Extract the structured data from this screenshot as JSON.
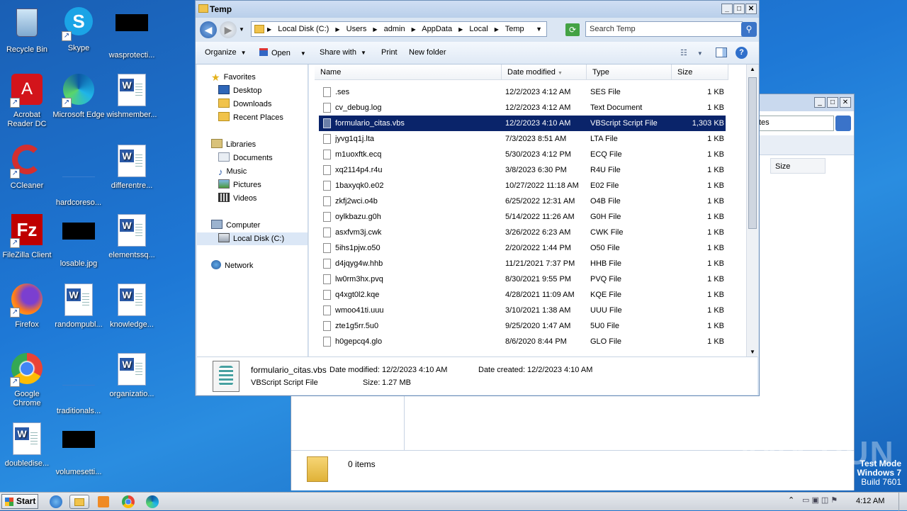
{
  "desktop": {
    "icons": [
      {
        "label": "Recycle Bin",
        "icon": "recycle-bin-icon"
      },
      {
        "label": "Skype",
        "icon": "skype-icon"
      },
      {
        "label": "wasprotecti...",
        "icon": "black-thumbnail-icon"
      },
      {
        "label": "Acrobat Reader DC",
        "icon": "acrobat-icon"
      },
      {
        "label": "Microsoft Edge",
        "icon": "edge-icon"
      },
      {
        "label": "wishmember...",
        "icon": "word-doc-icon"
      },
      {
        "label": "CCleaner",
        "icon": "ccleaner-icon"
      },
      {
        "label": "hardcoreso...",
        "icon": "blank-thumbnail-icon"
      },
      {
        "label": "differentre...",
        "icon": "word-doc-icon"
      },
      {
        "label": "FileZilla Client",
        "icon": "filezilla-icon"
      },
      {
        "label": "losable.jpg",
        "icon": "black-thumbnail-icon"
      },
      {
        "label": "elementssq...",
        "icon": "word-doc-icon"
      },
      {
        "label": "Firefox",
        "icon": "firefox-icon"
      },
      {
        "label": "randompubl...",
        "icon": "word-doc-icon"
      },
      {
        "label": "knowledge...",
        "icon": "word-doc-icon"
      },
      {
        "label": "Google Chrome",
        "icon": "chrome-icon"
      },
      {
        "label": "traditionals...",
        "icon": "blank-thumbnail-icon"
      },
      {
        "label": "organizatio...",
        "icon": "word-doc-icon"
      },
      {
        "label": "doubledise...",
        "icon": "word-doc-icon"
      },
      {
        "label": "volumesetti...",
        "icon": "black-thumbnail-icon"
      }
    ]
  },
  "back_window": {
    "search_text": "tes",
    "column_size": "Size",
    "status_items": "0 items"
  },
  "explorer": {
    "title": "Temp",
    "breadcrumb": [
      "Local Disk (C:)",
      "Users",
      "admin",
      "AppData",
      "Local",
      "Temp"
    ],
    "search_placeholder": "Search Temp",
    "toolbar": {
      "organize": "Organize",
      "open": "Open",
      "share_with": "Share with",
      "print": "Print",
      "new_folder": "New folder"
    },
    "nav": {
      "favorites": "Favorites",
      "desktop": "Desktop",
      "downloads": "Downloads",
      "recent_places": "Recent Places",
      "libraries": "Libraries",
      "documents": "Documents",
      "music": "Music",
      "pictures": "Pictures",
      "videos": "Videos",
      "computer": "Computer",
      "local_disk": "Local Disk (C:)",
      "network": "Network"
    },
    "columns": {
      "name": "Name",
      "date_modified": "Date modified",
      "type": "Type",
      "size": "Size"
    },
    "files": [
      {
        "name": ".ses",
        "date": "12/2/2023 4:12 AM",
        "type": "SES File",
        "size": "1 KB"
      },
      {
        "name": "cv_debug.log",
        "date": "12/2/2023 4:12 AM",
        "type": "Text Document",
        "size": "1 KB"
      },
      {
        "name": "formulario_citas.vbs",
        "date": "12/2/2023 4:10 AM",
        "type": "VBScript Script File",
        "size": "1,303 KB"
      },
      {
        "name": "jyvg1q1j.lta",
        "date": "7/3/2023 8:51 AM",
        "type": "LTA File",
        "size": "1 KB"
      },
      {
        "name": "m1uoxftk.ecq",
        "date": "5/30/2023 4:12 PM",
        "type": "ECQ File",
        "size": "1 KB"
      },
      {
        "name": "xq2114p4.r4u",
        "date": "3/8/2023 6:30 PM",
        "type": "R4U File",
        "size": "1 KB"
      },
      {
        "name": "1baxyqk0.e02",
        "date": "10/27/2022 11:18 AM",
        "type": "E02 File",
        "size": "1 KB"
      },
      {
        "name": "zkfj2wci.o4b",
        "date": "6/25/2022 12:31 AM",
        "type": "O4B File",
        "size": "1 KB"
      },
      {
        "name": "oylkbazu.g0h",
        "date": "5/14/2022 11:26 AM",
        "type": "G0H File",
        "size": "1 KB"
      },
      {
        "name": "asxfvm3j.cwk",
        "date": "3/26/2022 6:23 AM",
        "type": "CWK File",
        "size": "1 KB"
      },
      {
        "name": "5ihs1pjw.o50",
        "date": "2/20/2022 1:44 PM",
        "type": "O50 File",
        "size": "1 KB"
      },
      {
        "name": "d4jqyg4w.hhb",
        "date": "11/21/2021 7:37 PM",
        "type": "HHB File",
        "size": "1 KB"
      },
      {
        "name": "lw0rm3hx.pvq",
        "date": "8/30/2021 9:55 PM",
        "type": "PVQ File",
        "size": "1 KB"
      },
      {
        "name": "q4xgt0l2.kqe",
        "date": "4/28/2021 11:09 AM",
        "type": "KQE File",
        "size": "1 KB"
      },
      {
        "name": "wmoo41ti.uuu",
        "date": "3/10/2021 1:38 AM",
        "type": "UUU File",
        "size": "1 KB"
      },
      {
        "name": "zte1g5rr.5u0",
        "date": "9/25/2020 1:47 AM",
        "type": "5U0 File",
        "size": "1 KB"
      },
      {
        "name": "h0gepcq4.glo",
        "date": "8/6/2020 8:44 PM",
        "type": "GLO File",
        "size": "1 KB"
      }
    ],
    "selected_index": 2,
    "details": {
      "filename": "formulario_citas.vbs",
      "date_modified_label": "Date modified:",
      "date_modified": "12/2/2023 4:10 AM",
      "date_created_label": "Date created:",
      "date_created": "12/2/2023 4:10 AM",
      "type": "VBScript Script File",
      "size_label": "Size:",
      "size": "1.27 MB"
    }
  },
  "taskbar": {
    "start": "Start",
    "clock": "4:12 AM"
  },
  "watermark": {
    "line1": "Test Mode",
    "line2": "Windows 7",
    "line3": "Build 7601",
    "brand": "ANY RUN"
  }
}
